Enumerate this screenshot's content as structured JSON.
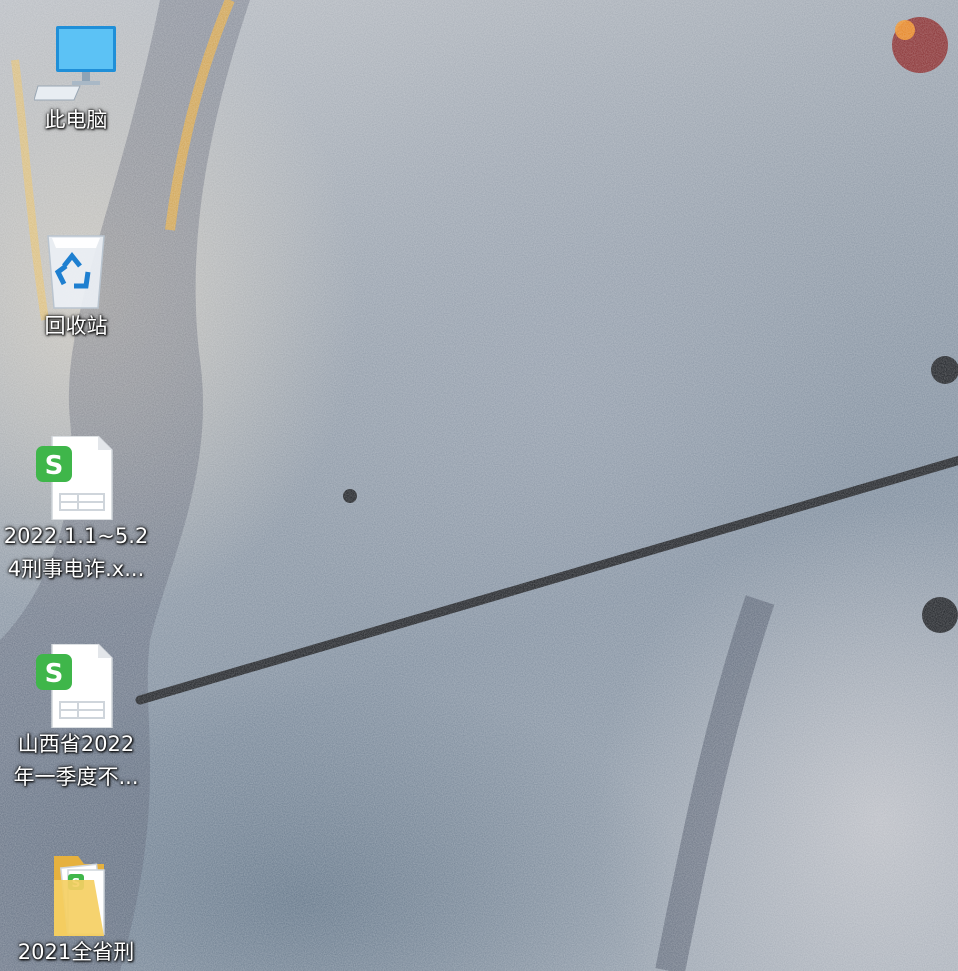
{
  "desktop": {
    "icons": [
      {
        "label_lines": [
          "此电脑"
        ],
        "icon": "this-pc-icon"
      },
      {
        "label_lines": [
          "回收站"
        ],
        "icon": "recycle-bin-icon"
      },
      {
        "label_lines": [
          "2022.1.1~5.2",
          "4刑事电诈.x..."
        ],
        "icon": "wps-spreadsheet-icon"
      },
      {
        "label_lines": [
          "山西省2022",
          "年一季度不..."
        ],
        "icon": "wps-spreadsheet-icon"
      },
      {
        "label_lines": [
          "2021全省刑"
        ],
        "icon": "folder-icon"
      }
    ]
  },
  "colors": {
    "wps_green": "#3fb64a",
    "folder_yellow": "#f2c14e",
    "monitor_blue": "#36a3e6"
  }
}
